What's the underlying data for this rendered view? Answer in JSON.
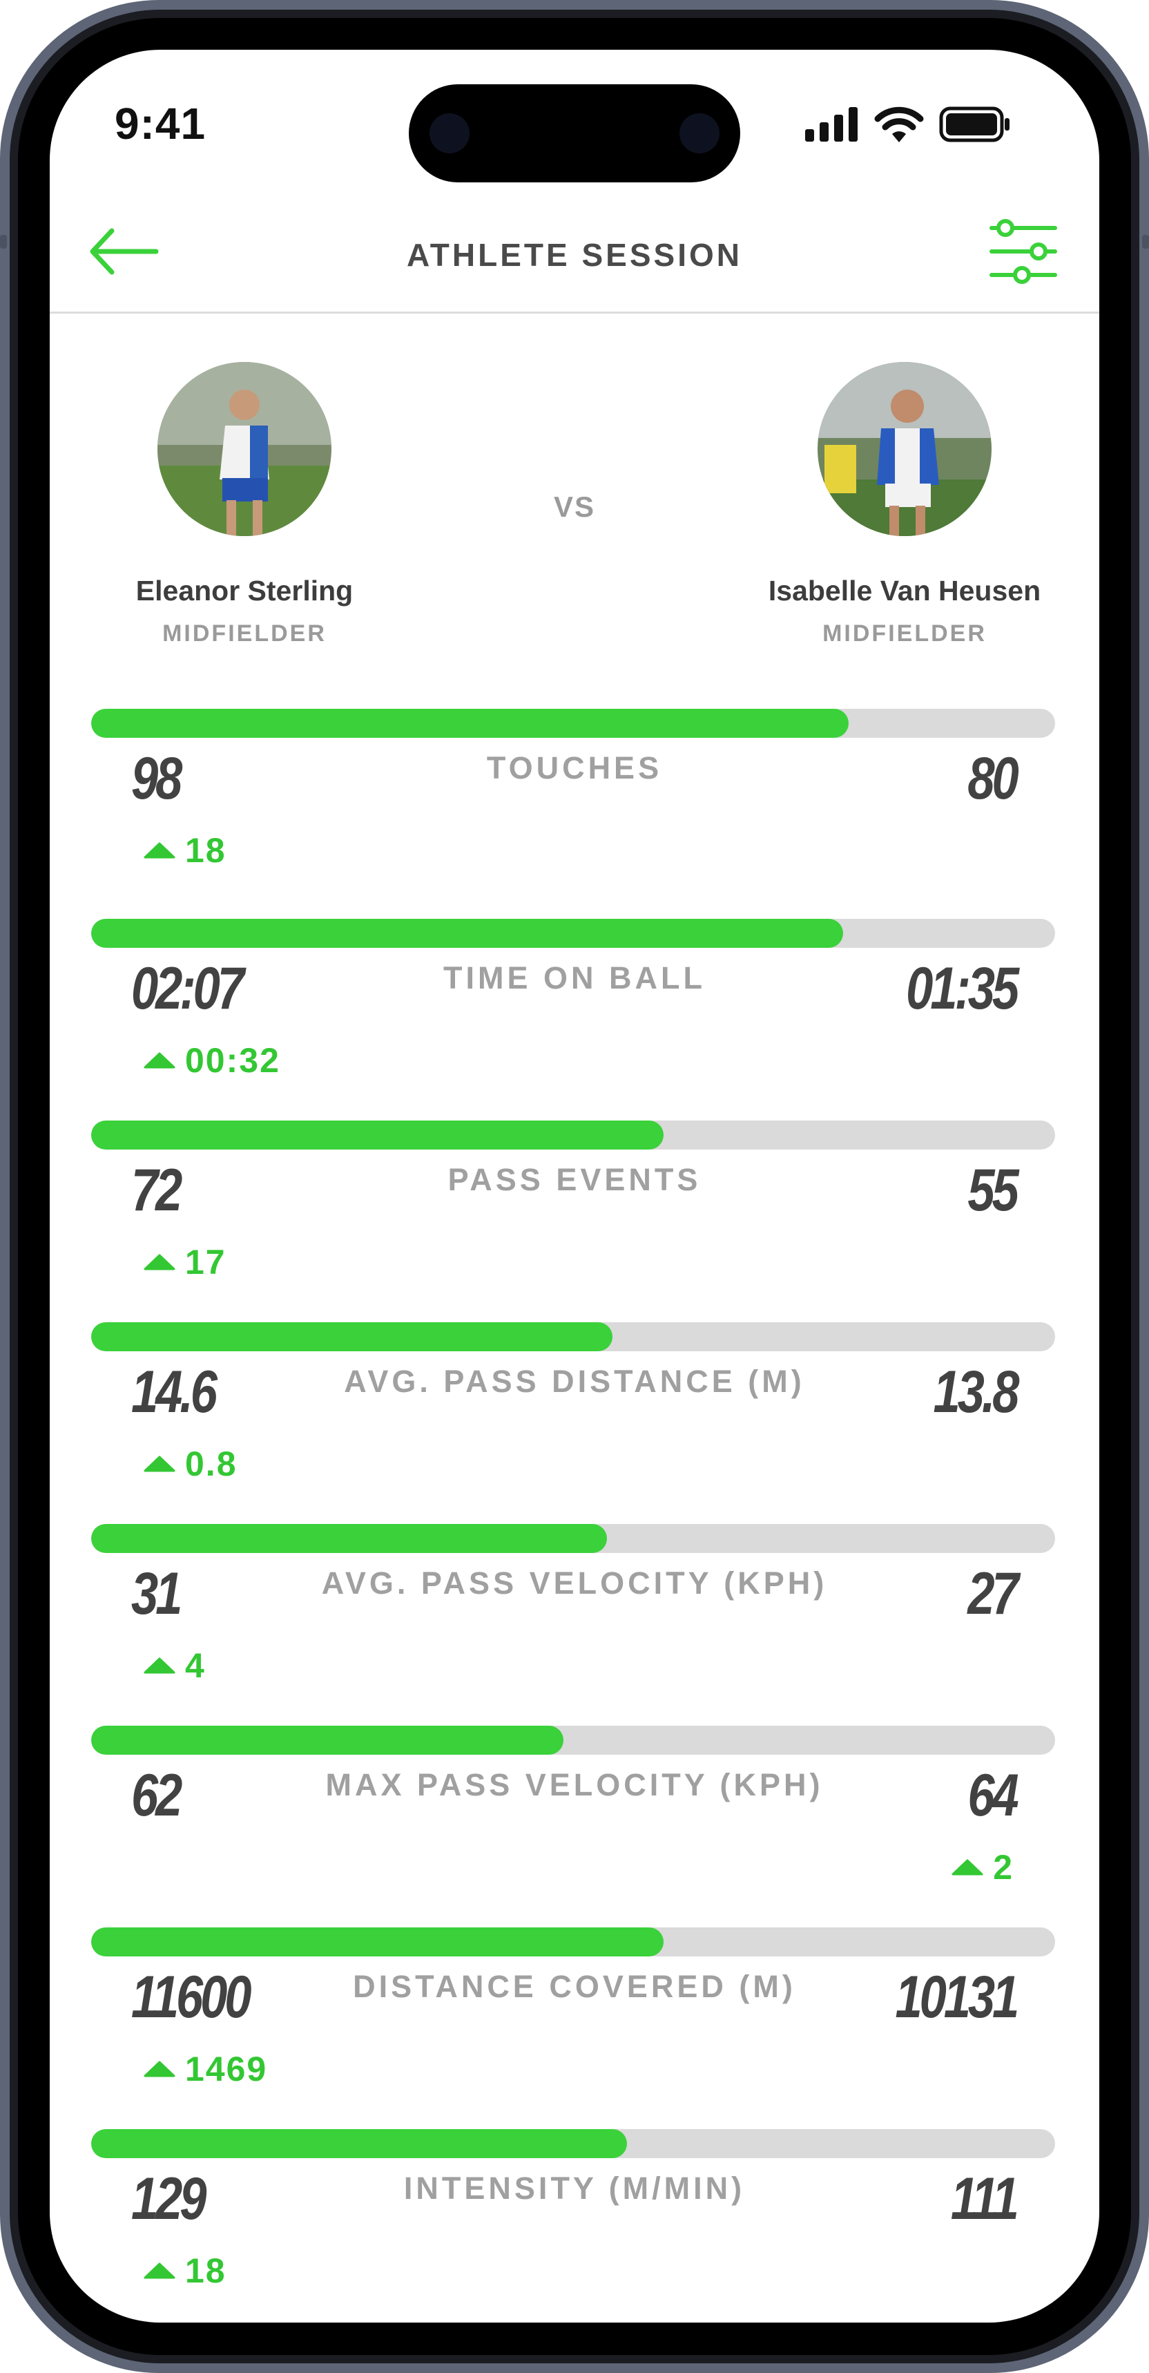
{
  "status_bar": {
    "time": "9:41"
  },
  "nav": {
    "title": "ATHLETE SESSION"
  },
  "players": {
    "left": {
      "name": "Eleanor Sterling",
      "position": "MIDFIELDER"
    },
    "right": {
      "name": "Isabelle Van Heusen",
      "position": "MIDFIELDER"
    },
    "vs_label": "VS"
  },
  "colors": {
    "accent": "#3ad13a",
    "track": "#dadada",
    "value": "#424242",
    "label": "#a0a0a0"
  },
  "metrics": [
    {
      "label": "TOUCHES",
      "left": "98",
      "right": "80",
      "delta": "18",
      "delta_side": "left",
      "fill_fraction": 0.786
    },
    {
      "label": "TIME ON BALL",
      "left": "02:07",
      "right": "01:35",
      "delta": "00:32",
      "delta_side": "left",
      "fill_fraction": 0.78
    },
    {
      "label": "PASS EVENTS",
      "left": "72",
      "right": "55",
      "delta": "17",
      "delta_side": "left",
      "fill_fraction": 0.594
    },
    {
      "label": "AVG. PASS DISTANCE (M)",
      "left": "14.6",
      "right": "13.8",
      "delta": "0.8",
      "delta_side": "left",
      "fill_fraction": 0.541
    },
    {
      "label": "AVG. PASS VELOCITY (KPH)",
      "left": "31",
      "right": "27",
      "delta": "4",
      "delta_side": "left",
      "fill_fraction": 0.535
    },
    {
      "label": "MAX PASS VELOCITY (KPH)",
      "left": "62",
      "right": "64",
      "delta": "2",
      "delta_side": "right",
      "fill_fraction": 0.49
    },
    {
      "label": "DISTANCE COVERED (M)",
      "left": "11600",
      "right": "10131",
      "delta": "1469",
      "delta_side": "left",
      "fill_fraction": 0.594
    },
    {
      "label": "INTENSITY (M/MIN)",
      "left": "129",
      "right": "111",
      "delta": "18",
      "delta_side": "left",
      "fill_fraction": 0.556
    }
  ]
}
